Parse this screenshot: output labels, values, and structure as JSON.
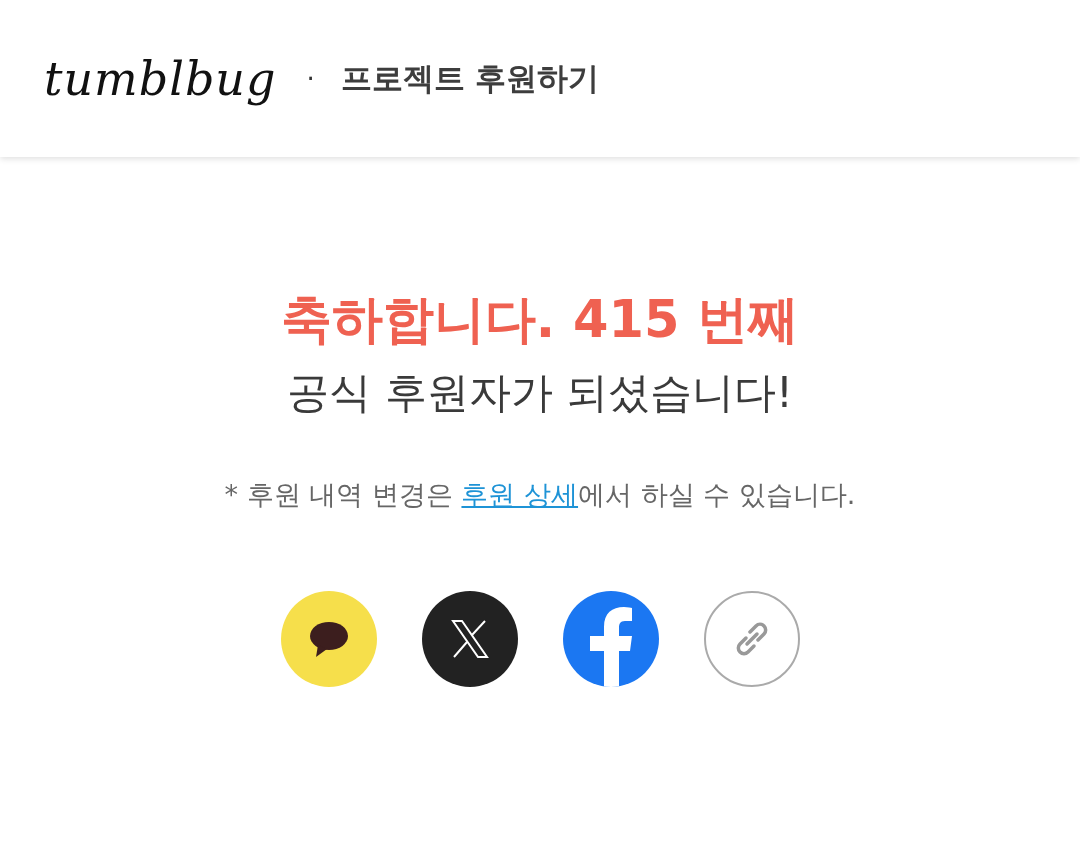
{
  "header": {
    "logo": "tumblbug",
    "separator": "·",
    "title": "프로젝트 후원하기"
  },
  "message": {
    "headline": "축하합니다. 415 번째",
    "subtitle": "공식 후원자가 되셨습니다!",
    "note_before": "* 후원 내역 변경은 ",
    "note_link": "후원 상세",
    "note_after": "에서 하실 수 있습니다."
  },
  "share_buttons": [
    {
      "kind": "kakao"
    },
    {
      "kind": "x"
    },
    {
      "kind": "facebook"
    },
    {
      "kind": "link"
    }
  ]
}
